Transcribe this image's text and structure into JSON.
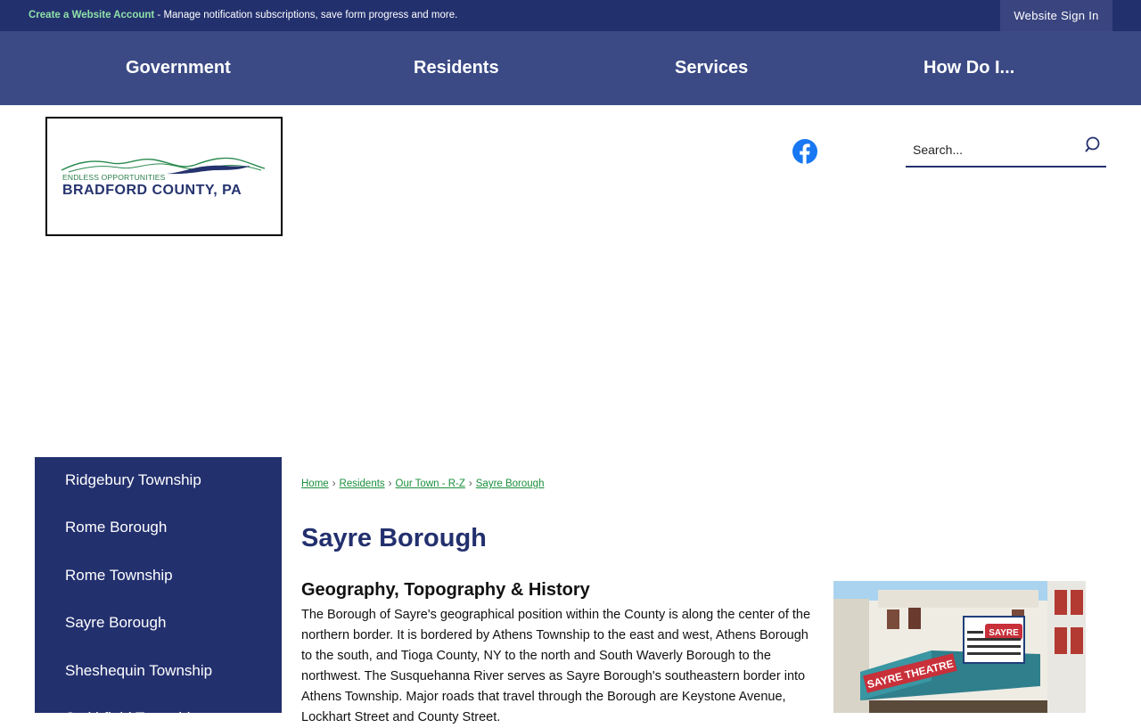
{
  "topbar": {
    "account_link": "Create a Website Account",
    "account_message": " - Manage notification subscriptions, save form progress and more.",
    "sign_in": "Website Sign In"
  },
  "nav": {
    "items": [
      {
        "label": "Government"
      },
      {
        "label": "Residents"
      },
      {
        "label": "Services"
      },
      {
        "label": "How Do I..."
      }
    ]
  },
  "logo": {
    "tagline": "ENDLESS OPPORTUNITIES",
    "name": "BRADFORD COUNTY, PA"
  },
  "search": {
    "placeholder": "Search..."
  },
  "icons": {
    "social": "facebook-icon",
    "search": "search-icon"
  },
  "colors": {
    "primary": "#23306e",
    "nav": "#3b4a85",
    "accent_green": "#1a8f3c",
    "facebook": "#1877f2"
  },
  "sidebar": {
    "items": [
      {
        "label": "Ridgebury Township"
      },
      {
        "label": "Rome Borough"
      },
      {
        "label": "Rome Township"
      },
      {
        "label": "Sayre Borough"
      },
      {
        "label": "Sheshequin Township"
      },
      {
        "label": "Smithfield Township"
      }
    ]
  },
  "breadcrumb": {
    "items": [
      {
        "label": "Home"
      },
      {
        "label": "Residents"
      },
      {
        "label": "Our Town - R-Z"
      },
      {
        "label": "Sayre Borough"
      }
    ]
  },
  "page": {
    "title": "Sayre Borough",
    "section_heading": "Geography, Topography & History",
    "paragraph": "The Borough of Sayre's geographical position within the County is along the center of the northern border. It is bordered by Athens Township to the east and west, Athens Borough to the south, and Tioga County, NY to the north and South Waverly Borough to the northwest. The Susquehanna River serves as Sayre Borough's southeastern border into Athens Township. Major roads that travel through the Borough are Keystone Avenue, Lockhart Street and County Street."
  },
  "photo": {
    "marquee_name": "SAYRE THEATRE",
    "sign_text": "SAYRE"
  }
}
